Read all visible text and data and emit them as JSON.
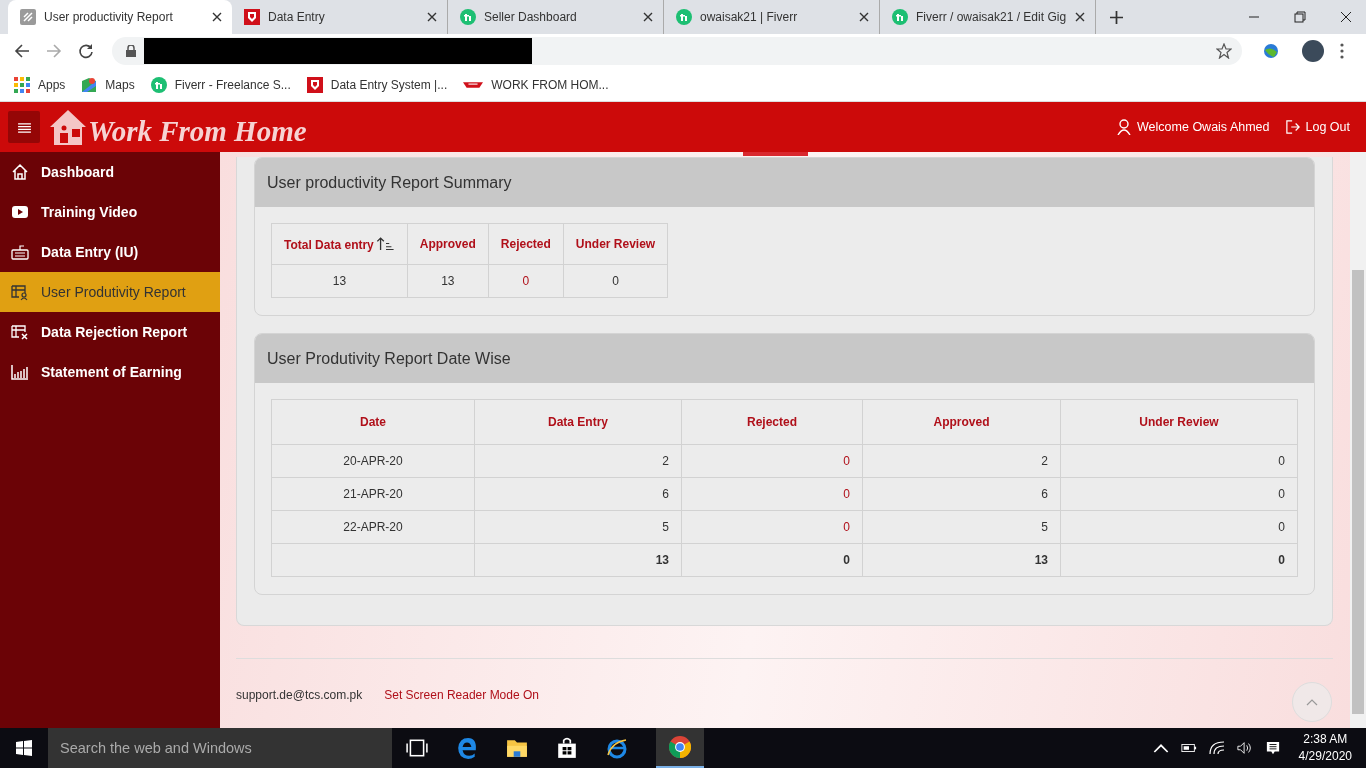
{
  "browser": {
    "tabs": [
      {
        "title": "User productivity Report",
        "kind": "report",
        "selected": true
      },
      {
        "title": "Data Entry",
        "kind": "tag",
        "selected": false
      },
      {
        "title": "Seller Dashboard",
        "kind": "fiverr",
        "selected": false
      },
      {
        "title": "owaisak21 | Fiverr",
        "kind": "fiverr",
        "selected": false
      },
      {
        "title": "Fiverr / owaisak21 / Edit Gig",
        "kind": "fiverr",
        "selected": false
      }
    ],
    "bookmarks": [
      {
        "label": "Apps",
        "kind": "apps"
      },
      {
        "label": "Maps",
        "kind": "maps"
      },
      {
        "label": "Fiverr - Freelance S...",
        "kind": "fiverr"
      },
      {
        "label": "Data Entry System |...",
        "kind": "tag"
      },
      {
        "label": "WORK FROM HOM...",
        "kind": "logo"
      }
    ]
  },
  "header": {
    "brand": "Work From Home",
    "welcome": "Welcome Owais Ahmed",
    "logout": "Log Out"
  },
  "sidebar": {
    "items": [
      {
        "label": "Dashboard",
        "kind": "home",
        "selected": false
      },
      {
        "label": "Training Video",
        "kind": "video",
        "selected": false
      },
      {
        "label": "Data Entry (IU)",
        "kind": "keyboard",
        "selected": false
      },
      {
        "label": "User Produtivity Report",
        "kind": "report",
        "selected": true
      },
      {
        "label": "Data Rejection Report",
        "kind": "reject",
        "selected": false
      },
      {
        "label": "Statement of Earning",
        "kind": "chart",
        "selected": false
      }
    ]
  },
  "summary": {
    "title": "User productivity Report Summary",
    "columns": [
      "Total Data entry",
      "Approved",
      "Rejected",
      "Under Review"
    ],
    "row": [
      "13",
      "13",
      "0",
      "0"
    ]
  },
  "datewise": {
    "title": "User Produtivity Report Date Wise",
    "columns": [
      "Date",
      "Data Entry",
      "Rejected",
      "Approved",
      "Under Review"
    ],
    "rows": [
      [
        "20-APR-20",
        "2",
        "0",
        "2",
        "0"
      ],
      [
        "21-APR-20",
        "6",
        "0",
        "6",
        "0"
      ],
      [
        "22-APR-20",
        "5",
        "0",
        "5",
        "0"
      ]
    ],
    "totals": [
      "13",
      "0",
      "13",
      "0"
    ]
  },
  "footer": {
    "email": "support.de@tcs.com.pk",
    "screen_reader": "Set Screen Reader Mode On"
  },
  "taskbar": {
    "search_placeholder": "Search the web and Windows",
    "time": "2:38 AM",
    "date": "4/29/2020"
  }
}
